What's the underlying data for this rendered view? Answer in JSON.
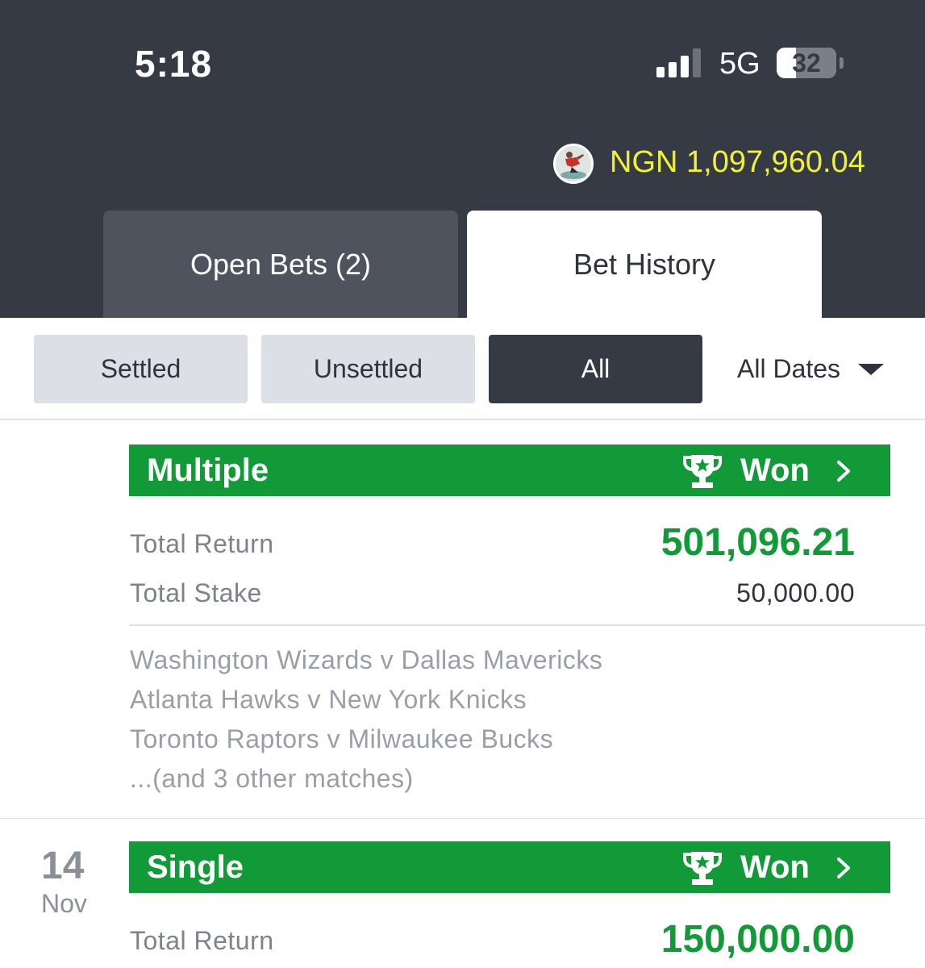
{
  "status_bar": {
    "time": "5:18",
    "network": "5G",
    "battery": "32",
    "battery_level": 0.32,
    "signal_bars_active": 3,
    "signal_bars_total": 4
  },
  "account": {
    "balance": "NGN 1,097,960.04",
    "balance_color": "#f2f234"
  },
  "tabs": [
    {
      "label": "Open Bets (2)",
      "active": false
    },
    {
      "label": "Bet History",
      "active": true
    }
  ],
  "filters": {
    "settled": "Settled",
    "unsettled": "Unsettled",
    "all": "All",
    "active": "All",
    "date_filter": "All Dates"
  },
  "bets": [
    {
      "type": "Multiple",
      "status": "Won",
      "total_return_label": "Total Return",
      "total_return": "501,096.21",
      "total_stake_label": "Total Stake",
      "total_stake": "50,000.00",
      "matches": [
        "Washington Wizards v Dallas Mavericks",
        "Atlanta Hawks v New York Knicks",
        "Toronto Raptors v Milwaukee Bucks",
        "...(and 3 other matches)"
      ]
    },
    {
      "date_day": "14",
      "date_month": "Nov",
      "type": "Single",
      "status": "Won",
      "total_return_label": "Total Return",
      "total_return": "150,000.00"
    }
  ],
  "colors": {
    "header_bg": "#353a45",
    "won_green": "#129a39",
    "inactive_tab": "#4f535e"
  }
}
